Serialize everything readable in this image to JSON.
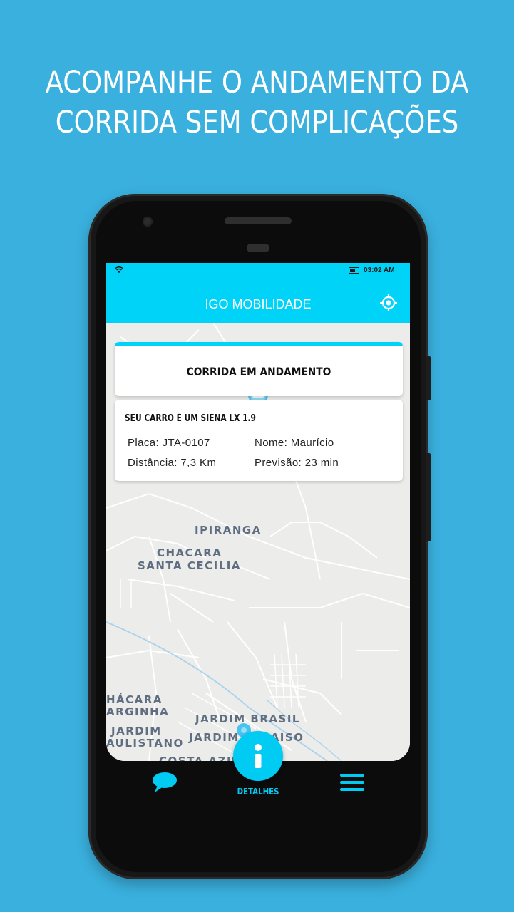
{
  "headline": {
    "line1": "ACOMPANHE O ANDAMENTO DA",
    "line2": "CORRIDA SEM COMPLICAÇÕES"
  },
  "status_bar": {
    "time": "03:02 AM"
  },
  "app_bar": {
    "title": "IGO MOBILIDADE",
    "locate_icon": "crosshair-icon"
  },
  "ride_status": {
    "text": "CORRIDA EM ANDAMENTO"
  },
  "ride_info": {
    "car": "SEU CARRO É UM SIENA LX 1.9",
    "plate": "Placa: JTA-0107",
    "driver": "Nome: Maurício",
    "distance": "Distância: 7,3 Km",
    "eta": "Previsão: 23 min"
  },
  "map_labels": {
    "ipiranga": "IPIRANGA",
    "chacara1": "CHACARA",
    "chacara2": "SANTA CECILIA",
    "chacara3": "HÁCARA",
    "margarinha": "ARGINHA",
    "jardim1": "JARDIM",
    "paulistano": "AULISTANO",
    "jardim_brasil": "JARDIM BRASIL",
    "jardim_paraiso": "JARDIM PARAISO",
    "costa_azul": "COSTA AZUL"
  },
  "bottom_nav": {
    "chat_icon": "chat-bubble-icon",
    "details_icon": "info-icon",
    "details_label": "DETALHES",
    "menu_icon": "hamburger-menu-icon"
  },
  "colors": {
    "background": "#3ab0de",
    "accent": "#00d3f8"
  }
}
